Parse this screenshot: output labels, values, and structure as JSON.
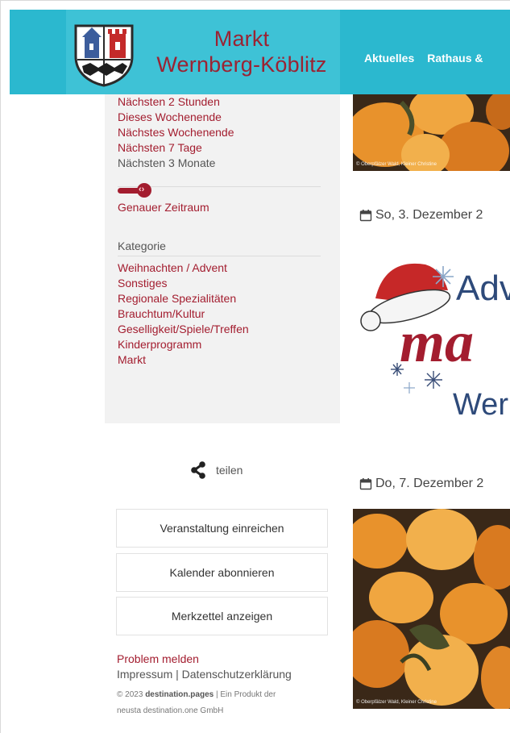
{
  "header": {
    "title_line1": "Markt",
    "title_line2": "Wernberg-Köblitz",
    "nav": [
      "Aktuelles",
      "Rathaus &"
    ]
  },
  "filters": {
    "time_options": [
      {
        "label": "Nächsten 2 Stunden",
        "active": true
      },
      {
        "label": "Dieses Wochenende",
        "active": true
      },
      {
        "label": "Nächstes Wochenende",
        "active": true
      },
      {
        "label": "Nächsten 7 Tage",
        "active": true
      },
      {
        "label": "Nächsten 3 Monate",
        "active": false
      }
    ],
    "exact_range": "Genauer Zeitraum",
    "category_heading": "Kategorie",
    "categories": [
      "Weihnachten / Advent",
      "Sonstiges",
      "Regionale Spezialitäten",
      "Brauchtum/Kultur",
      "Geselligkeit/Spiele/Treffen",
      "Kinderprogramm",
      "Markt"
    ]
  },
  "share": {
    "label": "teilen"
  },
  "buttons": {
    "submit": "Veranstaltung einreichen",
    "subscribe": "Kalender abonnieren",
    "notes": "Merkzettel anzeigen"
  },
  "footer": {
    "problem": "Problem melden",
    "imprint": "Impressum",
    "separator": "|",
    "privacy": "Datenschutzerklärung",
    "copyright_year": "© 2023",
    "brand": "destination.pages",
    "product_text": "| Ein Produkt der",
    "company": "neusta destination.one GmbH"
  },
  "events": [
    {
      "date": "So, 3. Dezember 2",
      "image_credit": "© Oberpfälzer Wald, Kleiner Christine"
    },
    {
      "date": "Do, 7. Dezember 2",
      "image_credit": "© Oberpfälzer Wald, Kleiner Christine"
    }
  ],
  "top_image_credit": "© Oberpfälzer Wald, Kleiner Christine",
  "advent_image": {
    "text_line1": "Adv",
    "text_line2": "ma",
    "text_line3": "Wern"
  },
  "colors": {
    "header": "#2bb8cf",
    "accent": "#a31d2f"
  }
}
